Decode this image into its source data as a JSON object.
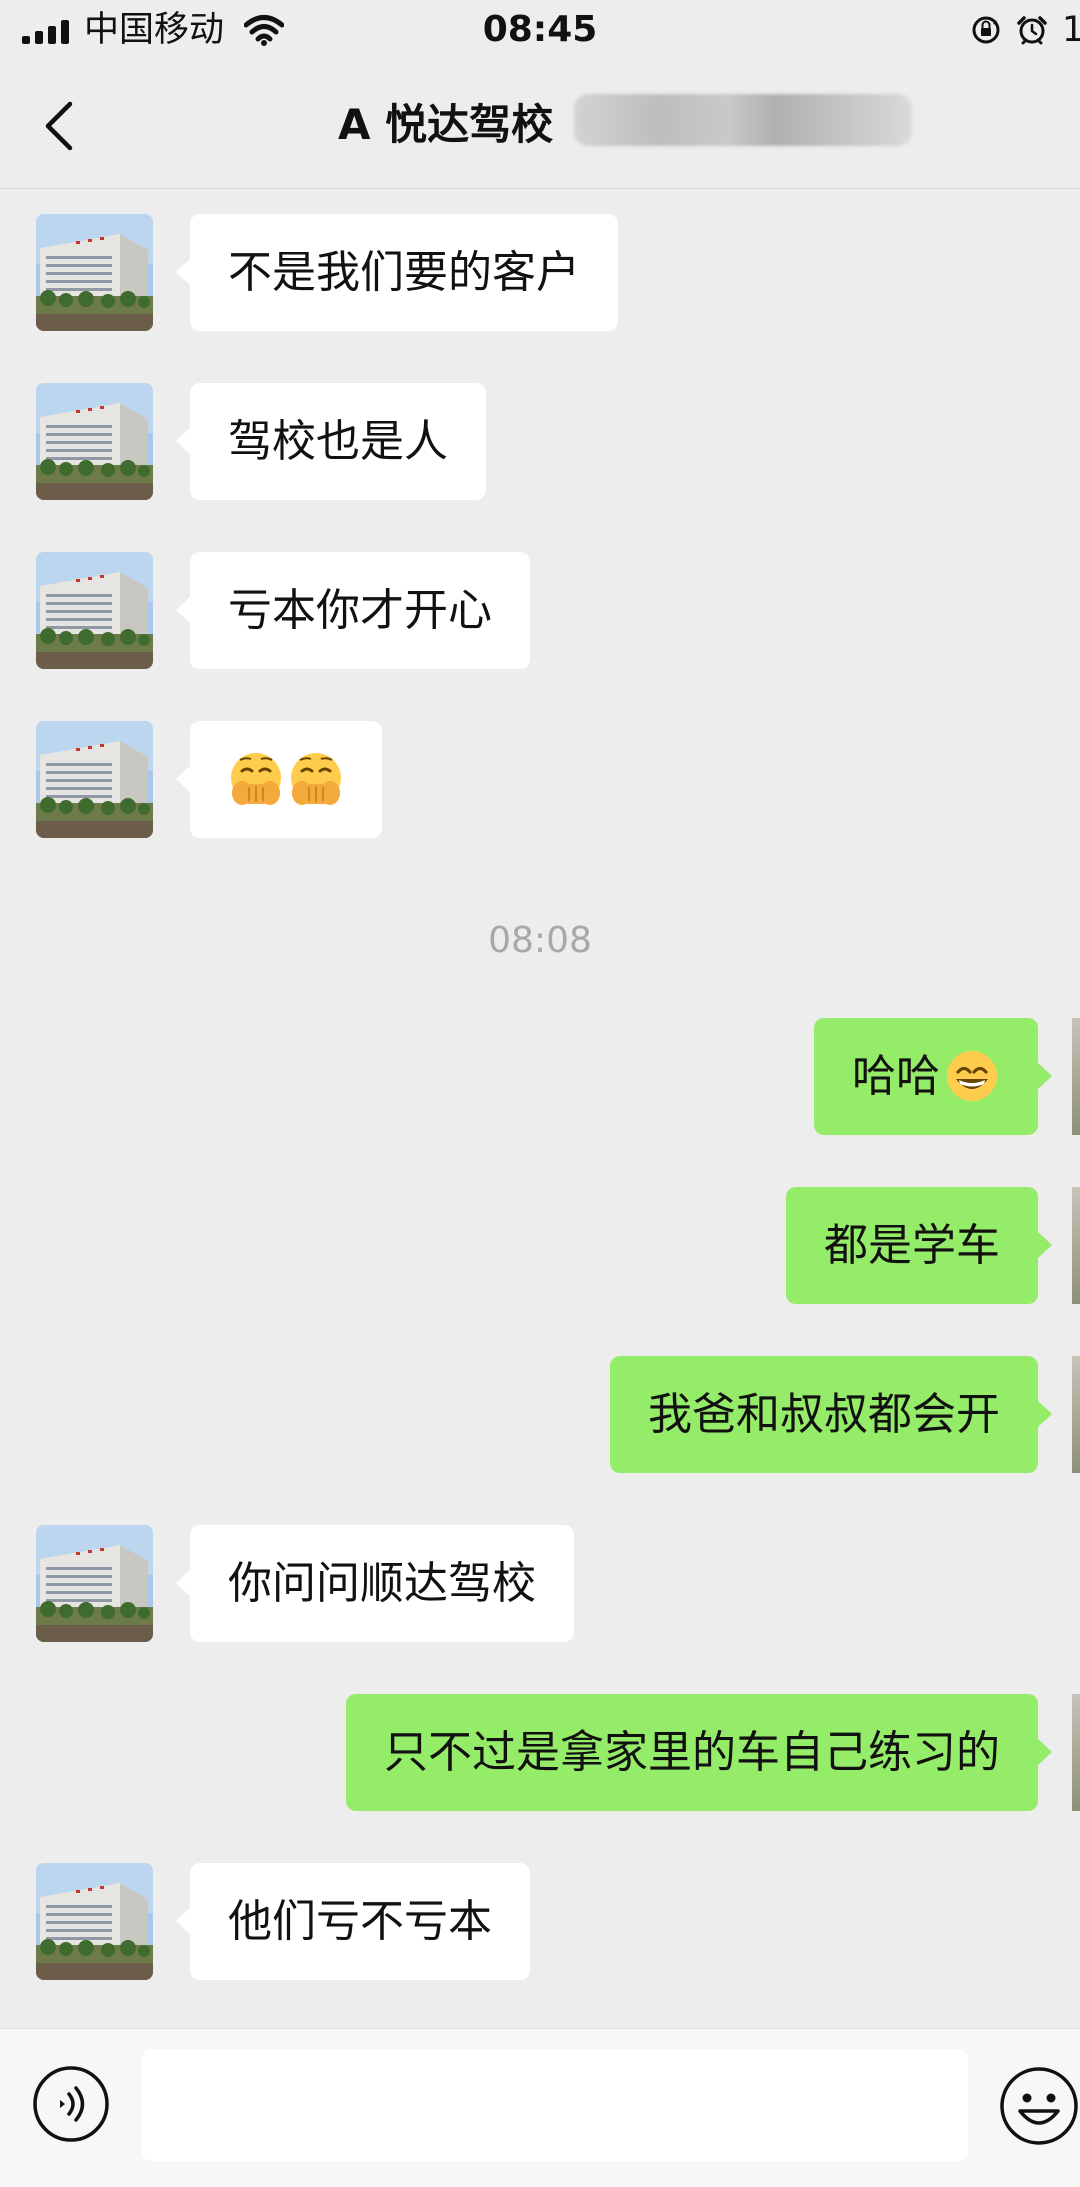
{
  "status_bar": {
    "carrier": "中国移动",
    "time": "08:45",
    "battery_text": "1",
    "icons": [
      "signal-icon",
      "wifi-icon",
      "rotation-lock-icon",
      "alarm-icon"
    ]
  },
  "header": {
    "title": "A 悦达驾校",
    "back_icon": "chevron-left-icon"
  },
  "colors": {
    "background": "#ededed",
    "received_bubble": "#ffffff",
    "sent_bubble": "#95ec69",
    "timestamp_text": "#a8a8a8",
    "input_bar": "#f7f7f7"
  },
  "messages": [
    {
      "direction": "received",
      "text": "不是我们要的客户"
    },
    {
      "direction": "received",
      "text": "驾校也是人"
    },
    {
      "direction": "received",
      "text": "亏本你才开心"
    },
    {
      "direction": "received",
      "text": "",
      "emoji": [
        "face-with-hand-over-mouth",
        "face-with-hand-over-mouth"
      ]
    },
    {
      "direction": "timestamp",
      "text": "08:08"
    },
    {
      "direction": "sent",
      "text": "哈哈",
      "emoji": [
        "grinning-face-with-smiling-eyes"
      ]
    },
    {
      "direction": "sent",
      "text": "都是学车"
    },
    {
      "direction": "sent",
      "text": "我爸和叔叔都会开"
    },
    {
      "direction": "received",
      "text": "你问问顺达驾校"
    },
    {
      "direction": "sent",
      "text": "只不过是拿家里的车自己练习的"
    },
    {
      "direction": "received",
      "text": "他们亏不亏本"
    }
  ],
  "input_bar": {
    "value": "",
    "placeholder": "",
    "left_icon": "voice-icon",
    "right_icon": "emoji-icon"
  }
}
